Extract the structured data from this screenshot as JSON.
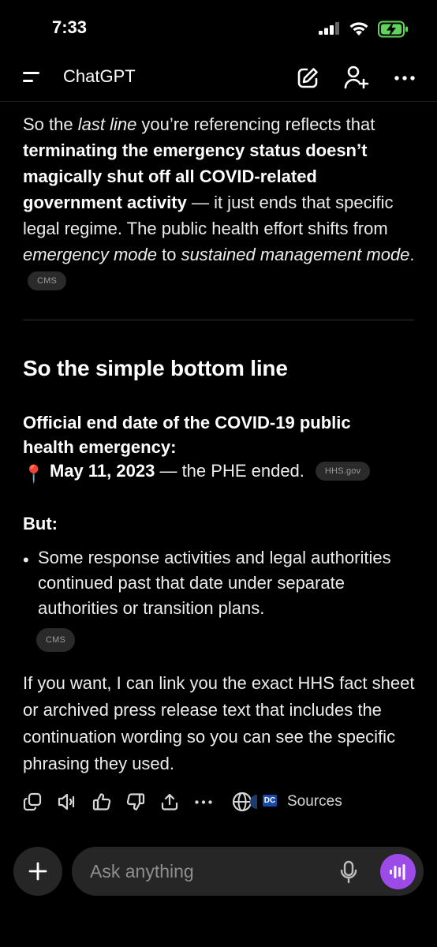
{
  "status": {
    "time": "7:33"
  },
  "header": {
    "title": "ChatGPT"
  },
  "message": {
    "p1_a": "So the ",
    "p1_i1": "last line",
    "p1_b": " you’re referencing reflects that ",
    "p1_bold": "terminating the emergency status doesn’t magically shut off all COVID-related government activity",
    "p1_c": " — it just ends that specific legal regime. The public health effort shifts from ",
    "p1_i2": "emergency mode",
    "p1_d": " to ",
    "p1_i3": "sustained management mode",
    "p1_e": ".",
    "p1_source": "CMS",
    "heading": "So the simple bottom line",
    "official_label": "Official end date of the COVID-19 public health emergency:",
    "date_pin": "📍",
    "date_bold": "May 11, 2023",
    "date_rest": " — the PHE ended.",
    "date_source": "HHS.gov",
    "but_label": "But:",
    "bullet_text": "Some response activities and legal authorities continued past that date under separate authorities or transition plans.",
    "bullet_source": "CMS",
    "closing": "If you want, I can link you the exact HHS fact sheet or archived press release text that includes the continuation wording so you can see the specific phrasing they used."
  },
  "actions": {
    "sources_label": "Sources",
    "sources_badge": "DC"
  },
  "composer": {
    "placeholder": "Ask anything"
  },
  "colors": {
    "background": "#000000",
    "chip_bg": "#2a2a2a",
    "voice_accent": "#9c4be8",
    "battery_green": "#5fd35a"
  }
}
